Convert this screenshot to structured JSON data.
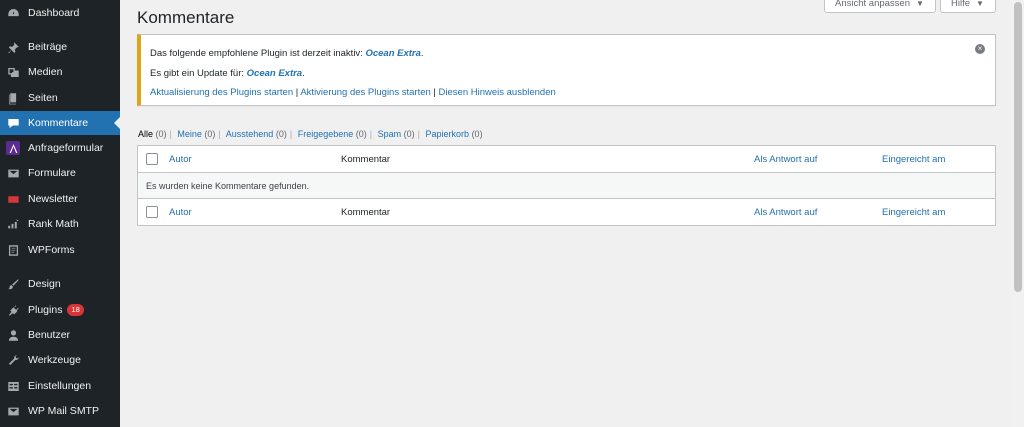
{
  "sidebar": {
    "items": [
      {
        "label": "Dashboard",
        "icon": "dashboard-icon"
      },
      {
        "label": "Beiträge",
        "icon": "pin-icon"
      },
      {
        "label": "Medien",
        "icon": "media-icon"
      },
      {
        "label": "Seiten",
        "icon": "pages-icon"
      },
      {
        "label": "Kommentare",
        "icon": "comment-icon"
      },
      {
        "label": "Anfrageformular",
        "icon": "form-icon"
      },
      {
        "label": "Formulare",
        "icon": "envelope-icon"
      },
      {
        "label": "Newsletter",
        "icon": "newsletter-icon"
      },
      {
        "label": "Rank Math",
        "icon": "chart-icon"
      },
      {
        "label": "WPForms",
        "icon": "wpforms-icon"
      },
      {
        "label": "Design",
        "icon": "brush-icon"
      },
      {
        "label": "Plugins",
        "icon": "plugin-icon",
        "badge": "18"
      },
      {
        "label": "Benutzer",
        "icon": "user-icon"
      },
      {
        "label": "Werkzeuge",
        "icon": "wrench-icon"
      },
      {
        "label": "Einstellungen",
        "icon": "settings-icon"
      },
      {
        "label": "WP Mail SMTP",
        "icon": "mail-icon"
      }
    ],
    "active_color": "#2271b1",
    "badge_color": "#d63638"
  },
  "header": {
    "screen_options": "Ansicht anpassen",
    "help": "Hilfe",
    "title": "Kommentare"
  },
  "notice": {
    "line1_text": "Das folgende empfohlene Plugin ist derzeit inaktiv:",
    "line1_plugin": "Ocean Extra",
    "line2_text": "Es gibt ein Update für:",
    "line2_plugin": "Ocean Extra",
    "link_update": "Aktualisierung des Plugins starten",
    "link_activate": "Aktivierung des Plugins starten",
    "link_hide": "Diesen Hinweis ausblenden",
    "border_color": "#dba617"
  },
  "filters": [
    {
      "label": "Alle",
      "count": "(0)"
    },
    {
      "label": "Meine",
      "count": "(0)"
    },
    {
      "label": "Ausstehend",
      "count": "(0)"
    },
    {
      "label": "Freigegebene",
      "count": "(0)"
    },
    {
      "label": "Spam",
      "count": "(0)"
    },
    {
      "label": "Papierkorb",
      "count": "(0)"
    }
  ],
  "table": {
    "columns": [
      "Autor",
      "Kommentar",
      "Als Antwort auf",
      "Eingereicht am"
    ],
    "empty_message": "Es wurden keine Kommentare gefunden."
  }
}
